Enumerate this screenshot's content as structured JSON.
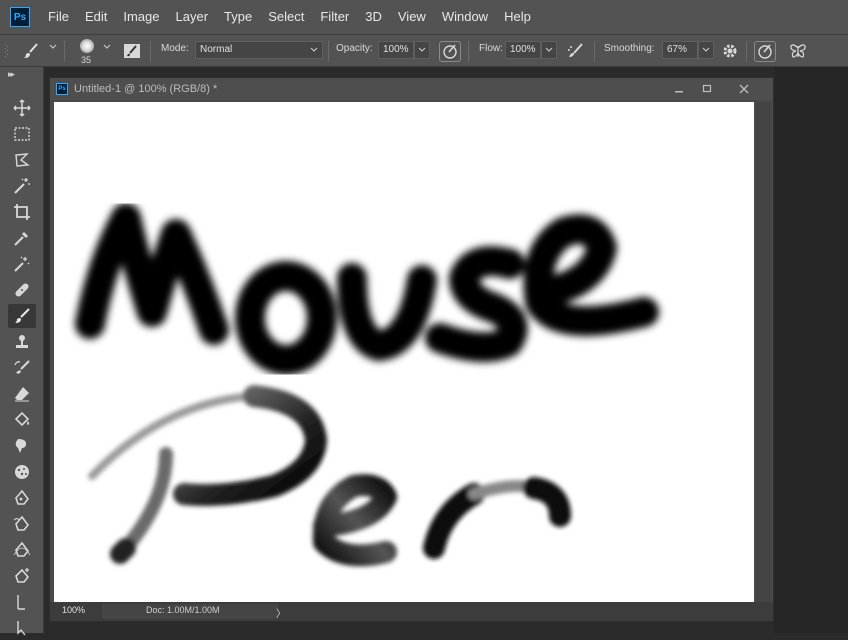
{
  "app": {
    "logo_text": "Ps",
    "accent_color": "#31a8ff"
  },
  "menu": [
    "File",
    "Edit",
    "Image",
    "Layer",
    "Type",
    "Select",
    "Filter",
    "3D",
    "View",
    "Window",
    "Help"
  ],
  "options_bar": {
    "brush_size": "35",
    "mode_label": "Mode:",
    "mode_value": "Normal",
    "opacity_label": "Opacity:",
    "opacity_value": "100%",
    "flow_label": "Flow:",
    "flow_value": "100%",
    "smoothing_label": "Smoothing:",
    "smoothing_value": "67%"
  },
  "tools": [
    "move-tool-icon",
    "marquee-tool-icon",
    "lasso-tool-icon",
    "magic-wand-icon",
    "crop-tool-icon",
    "eyedropper-icon",
    "spot-healing-icon",
    "bandage-icon",
    "brush-tool-icon",
    "clone-stamp-icon",
    "history-brush-icon",
    "eraser-icon",
    "paint-bucket-icon",
    "smudge-icon",
    "sponge-icon",
    "pen-tool-icon",
    "freeform-pen-icon",
    "curvature-pen-icon",
    "add-anchor-icon",
    "path-selection-icon",
    "direct-selection-icon"
  ],
  "active_tool": "brush-tool-icon",
  "document": {
    "title": "Untitled-1 @ 100% (RGB/8) *",
    "zoom": "100%",
    "doc_size": "Doc: 1.00M/1.00M",
    "status_arrow": "〉"
  },
  "canvas_text": {
    "line1": "Mouse",
    "line2": "Pen"
  }
}
